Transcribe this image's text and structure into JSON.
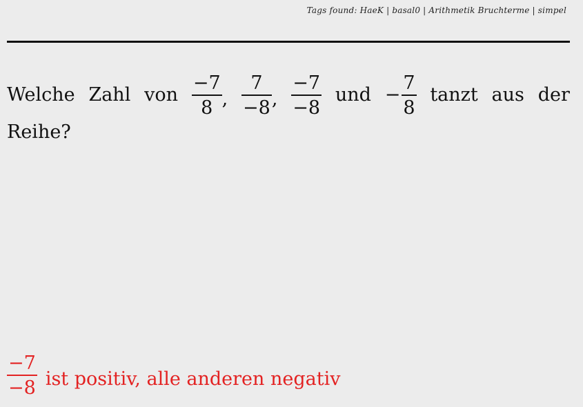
{
  "header": {
    "tags": "Tags found: HaeK | basal0 | Arithmetik Bruchterme | simpel"
  },
  "question": {
    "w1": "Welche",
    "w2": "Zahl",
    "w3": "von",
    "f1": {
      "num": "−7",
      "den": "8"
    },
    "sep1": ",",
    "f2": {
      "num": "7",
      "den": "−8"
    },
    "sep2": ",",
    "f3": {
      "num": "−7",
      "den": "−8"
    },
    "w4": "und",
    "f4_sign": "−",
    "f4": {
      "num": "7",
      "den": "8"
    },
    "w5": "tanzt",
    "w6": "aus",
    "w7": "der",
    "line2": "Reihe?"
  },
  "answer": {
    "frac": {
      "num": "−7",
      "den": "−8"
    },
    "text": "ist positiv, alle anderen negativ",
    "color": "#e32222"
  }
}
